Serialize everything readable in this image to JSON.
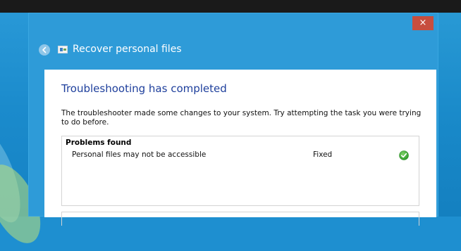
{
  "window": {
    "title": "Recover personal files",
    "close_label": "×",
    "accent_color": "#2e9bd8",
    "close_color": "#c74e3e"
  },
  "main": {
    "heading": "Troubleshooting has completed",
    "description": "The troubleshooter made some changes to your system. Try attempting the task you were trying to do before.",
    "heading_color": "#1e3f9c"
  },
  "problems": {
    "header": "Problems found",
    "items": [
      {
        "name": "Personal files may not be accessible",
        "status": "Fixed",
        "status_icon": "green-check-icon"
      }
    ]
  },
  "icons": {
    "back": "back-arrow-icon",
    "app": "troubleshooter-app-icon",
    "status": "green-check-icon"
  }
}
